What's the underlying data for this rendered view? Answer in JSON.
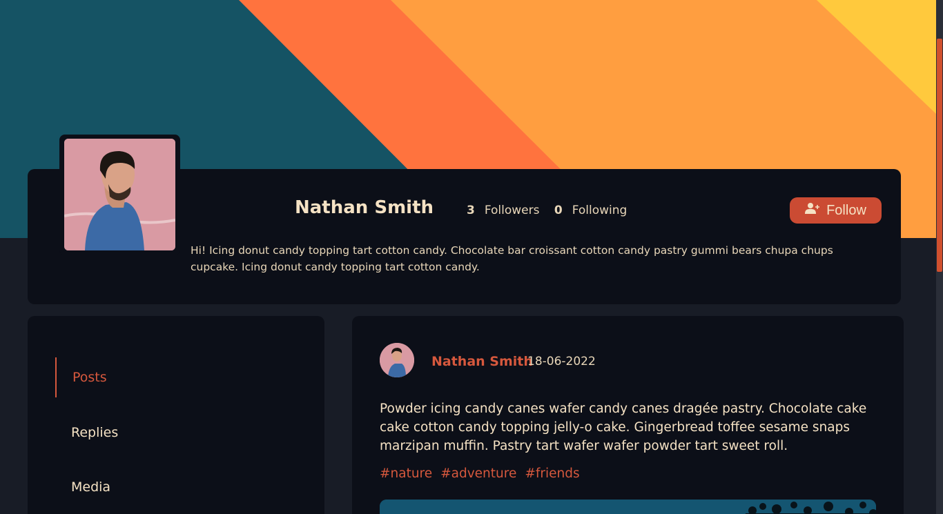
{
  "profile": {
    "name": "Nathan Smith",
    "followers_count": "3",
    "followers_label": "Followers",
    "following_count": "0",
    "following_label": "Following",
    "follow_button": "Follow",
    "bio": "Hi! Icing donut candy topping tart cotton candy. Chocolate bar croissant cotton candy pastry gummi bears chupa chups cupcake. Icing donut candy topping tart cotton candy."
  },
  "sidebar": {
    "items": [
      {
        "label": "Posts",
        "active": true
      },
      {
        "label": "Replies",
        "active": false
      },
      {
        "label": "Media",
        "active": false
      }
    ]
  },
  "post": {
    "author": "Nathan Smith",
    "date": "18-06-2022",
    "text": "Powder icing candy canes wafer candy canes dragée pastry. Chocolate cake cake cotton candy topping jelly-o cake. Gingerbread toffee sesame snaps marzipan muffin. Pastry tart wafer wafer powder tart sweet roll.",
    "tags": [
      "#nature",
      "#adventure",
      "#friends"
    ]
  },
  "colors": {
    "accent": "#d6583d",
    "button": "#cb4b33",
    "card_bg": "#0c0f18",
    "page_bg": "#181c26",
    "banner_teal": "#155364",
    "banner_orange": "#ff733e",
    "banner_light_orange": "#ff9e40",
    "banner_yellow": "#ffc93d"
  },
  "icons": {
    "follow": "user-plus-icon"
  }
}
